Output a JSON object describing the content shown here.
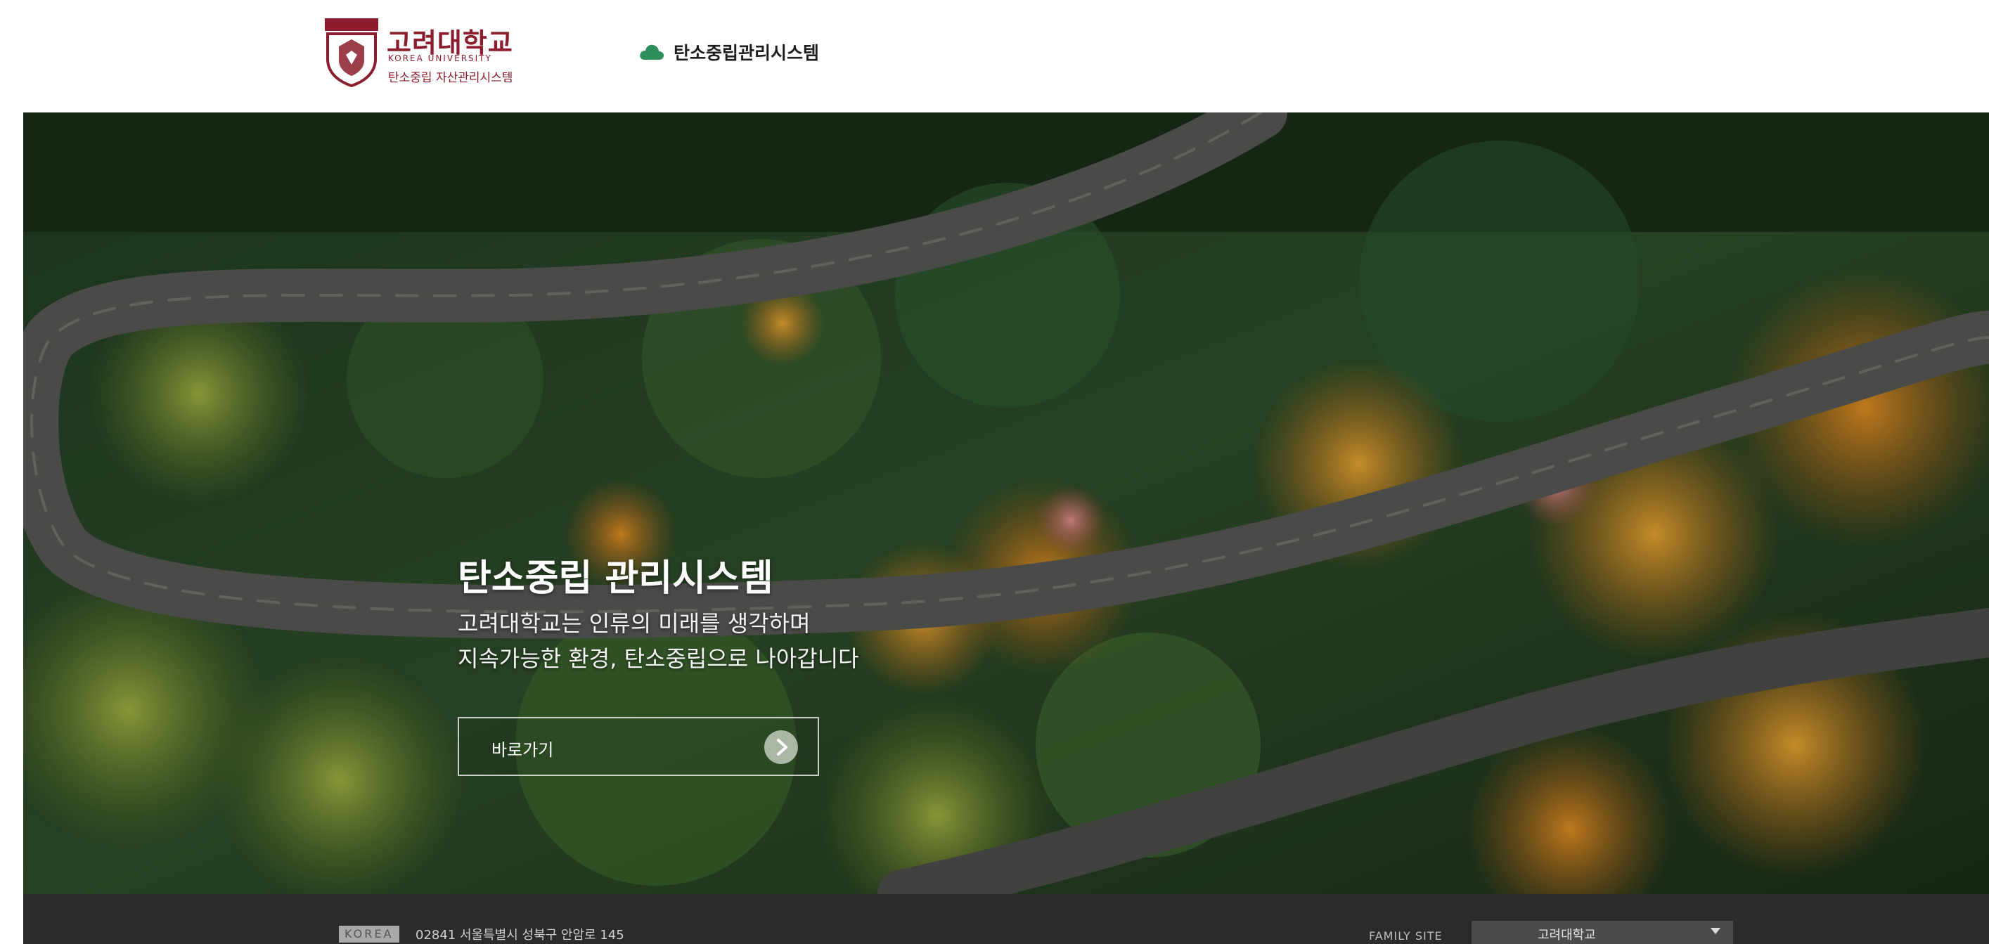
{
  "header": {
    "logo": {
      "name_kr": "고려대학교",
      "name_en": "KOREA UNIVERSITY",
      "subtitle": "탄소중립 자산관리시스템"
    },
    "system_link": {
      "label": "탄소중립관리시스템",
      "icon": "cloud-icon"
    }
  },
  "hero": {
    "title": "탄소중립 관리시스템",
    "description_lines": [
      "고려대학교는 인류의 미래를 생각하며",
      "지속가능한 환경, 탄소중립으로 나아갑니다"
    ],
    "button": {
      "label": "바로가기",
      "icon": "arrow-right-icon"
    }
  },
  "footer": {
    "logo_text": "KOREA",
    "address": "02841 서울특별시 성북구 안암로 145",
    "family_site": {
      "label": "FAMILY SITE",
      "selected": "고려대학교"
    }
  },
  "colors": {
    "brand": "#8b1d2c",
    "cloud_icon": "#2f8f5b",
    "footer_bg": "#2b2b2b"
  }
}
